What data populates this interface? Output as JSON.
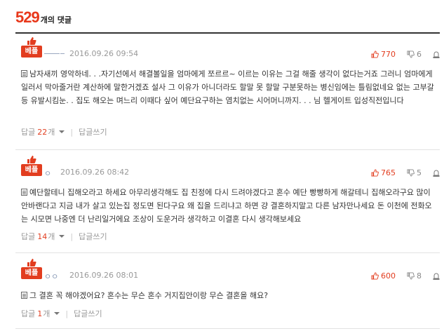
{
  "header": {
    "count": "529",
    "count_label": "개의 댓글"
  },
  "colors": {
    "accent": "#e23d1f",
    "count": "#e8381b"
  },
  "comments": [
    {
      "best_label": "베플",
      "nickname": "",
      "date": "2016.09.26 09:54",
      "upvotes": "770",
      "downvotes": "6",
      "body": "남자새끼 영악하네. . .자기선에서 해결볼일을 엄마에게 쪼르르~ 이르는 이유는 그걸 해줄 생각이 없다는거죠 그러니 엄마에게 일러서 막아줄거란 계산하에 말한거겠죠 설사 그 이유가 아니더라도 할말 못 할말 구분못하는 병신임에는 틀림없네요 없는 고부갈등 유발시킴눈. . 집도 해오는 며느리 이때다 싶어 예단요구하는 염치없는 시어머니까지. . . 님 헬게이트 입성직전입니다",
      "reply_label": "답글",
      "reply_count": "22",
      "reply_unit": "개",
      "write_reply": "답글쓰기"
    },
    {
      "best_label": "베플",
      "nickname": "ㅇ",
      "date": "2016.09.26 08:42",
      "upvotes": "765",
      "downvotes": "5",
      "body": "예단할테니 집해오라고 하세요 아무리생각해도 집 친정에 다시 드려야겠다고 혼수 예단 빵빵하게 해갈테니 집해오라구요 많이 안바랜다고 지금 내가 살고 있는집 정도면 된다구요 왜 집을 드리냐고 하면 걍 결혼하지말고 다른 남자만나세요 돈 이천에 전화오는 시모면 나중엔 더 난리일거에요 조상이 도운거라 생각하고 이결혼 다시 생각해보세요",
      "reply_label": "답글",
      "reply_count": "14",
      "reply_unit": "개",
      "write_reply": "답글쓰기"
    },
    {
      "best_label": "베플",
      "nickname": "ㅇㅇ",
      "date": "2016.09.26 08:01",
      "upvotes": "600",
      "downvotes": "8",
      "body": "그 결혼 꼭 해야겠어요? 혼수는 무슨 혼수 거지집안이랑 무슨 결혼을 해요?",
      "reply_label": "답글",
      "reply_count": "1",
      "reply_unit": "개",
      "write_reply": "답글쓰기"
    }
  ],
  "icons": {
    "best": "thumbs-up-icon",
    "up": "thumbs-up-icon",
    "down": "thumbs-down-icon",
    "report": "siren-icon",
    "note": "note-icon",
    "caret": "caret-down-icon"
  }
}
